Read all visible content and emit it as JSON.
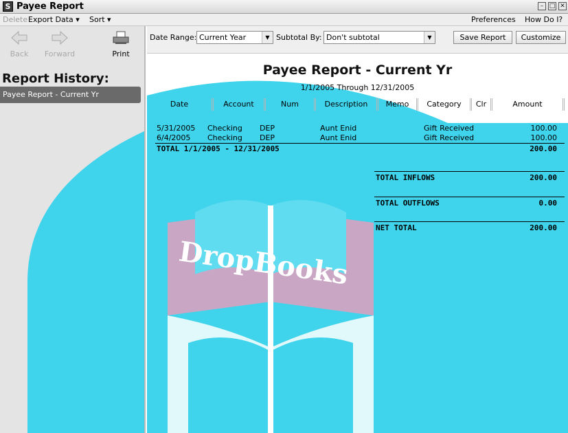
{
  "window": {
    "title": "Payee Report",
    "app_icon": "S"
  },
  "menu": {
    "delete": "Delete",
    "export": "Export Data ▾",
    "sort": "Sort ▾",
    "preferences": "Preferences",
    "how_do_i": "How Do I?"
  },
  "nav": {
    "back": "Back",
    "forward": "Forward",
    "print": "Print"
  },
  "history": {
    "title": "Report History:",
    "items": [
      "Payee Report - Current Yr"
    ]
  },
  "toolbar": {
    "date_range_label": "Date Range:",
    "date_range_value": "Current Year",
    "subtotal_label": "Subtotal By:",
    "subtotal_value": "Don't subtotal",
    "save_report": "Save Report",
    "customize": "Customize"
  },
  "report": {
    "title": "Payee Report - Current Yr",
    "range": "1/1/2005 Through 12/31/2005",
    "columns": [
      "Date",
      "Account",
      "Num",
      "Description",
      "Memo",
      "Category",
      "Clr",
      "Amount"
    ],
    "rows": [
      {
        "date": "5/31/2005",
        "account": "Checking",
        "num": "DEP",
        "description": "Aunt Enid",
        "memo": "",
        "category": "Gift Received",
        "clr": "",
        "amount": "100.00"
      },
      {
        "date": "6/4/2005",
        "account": "Checking",
        "num": "DEP",
        "description": "Aunt Enid",
        "memo": "",
        "category": "Gift Received",
        "clr": "",
        "amount": "100.00"
      }
    ],
    "total_label": "TOTAL 1/1/2005 - 12/31/2005",
    "total_amount": "200.00",
    "inflows_label": "TOTAL INFLOWS",
    "inflows_amount": "200.00",
    "outflows_label": "TOTAL OUTFLOWS",
    "outflows_amount": "0.00",
    "net_label": "NET TOTAL",
    "net_amount": "200.00"
  },
  "watermark": {
    "text": "DropBooks"
  },
  "colors": {
    "history_selected": "#6a6a6a",
    "watermark_cyan": "#3fd3ec"
  }
}
